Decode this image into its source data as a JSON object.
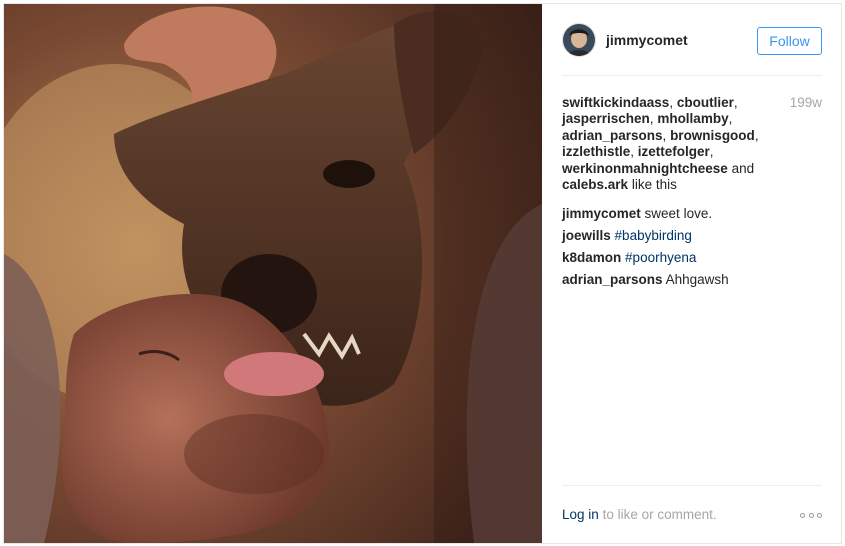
{
  "post": {
    "username": "jimmycomet",
    "follow_label": "Follow",
    "time_ago": "199w",
    "likes": {
      "users": [
        "swiftkickindaass",
        "cboutlier",
        "jasperrischen",
        "mhollamby",
        "adrian_parsons",
        "brownisgood",
        "izzlethistle",
        "izettefolger",
        "werkinonmahnightcheese",
        "calebs.ark"
      ],
      "and_text": "and",
      "suffix": "like this"
    },
    "comments": [
      {
        "user": "jimmycomet",
        "text": "sweet love.",
        "is_tag": false
      },
      {
        "user": "joewills",
        "text": "#babybirding",
        "is_tag": true
      },
      {
        "user": "k8damon",
        "text": "#poorhyena",
        "is_tag": true
      },
      {
        "user": "adrian_parsons",
        "text": "Ahhgawsh",
        "is_tag": false
      }
    ],
    "footer": {
      "login_link": "Log in",
      "login_rest": "to like or comment.",
      "more_icon": "ellipsis-icon"
    },
    "colors": {
      "accent": "#3897f0",
      "link": "#003569",
      "muted": "#a6a6a6",
      "text": "#262626"
    }
  }
}
